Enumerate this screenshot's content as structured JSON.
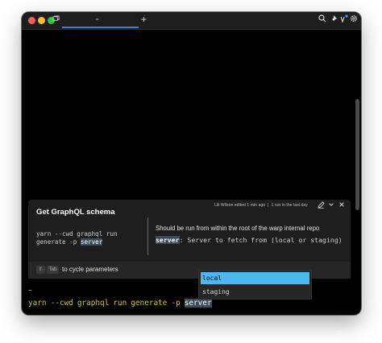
{
  "titlebar": {
    "tab_label": "-",
    "new_tab_label": "+"
  },
  "workflow": {
    "title": "Get GraphQL schema",
    "meta_author": "Lili Wilson edited 1 min ago",
    "meta_separator": "|",
    "meta_runs": "1 run in the last day",
    "command_line1": "yarn --cwd graphql run",
    "command_line2_prefix": "generate -p",
    "command_param": "server",
    "description": "Should be run from within the root of the warp internal repo",
    "param_name": "server",
    "param_description": ": Server to fetch from (local or staging)",
    "hint_key1": "⇧",
    "hint_key2": "Tab",
    "hint_text": "to cycle parameters"
  },
  "terminal": {
    "cwd": "~",
    "tokens": [
      "yarn",
      "--cwd",
      "graphql",
      "run",
      "generate",
      "-p"
    ],
    "param": "server"
  },
  "dropdown": {
    "options": [
      "local",
      "staging"
    ],
    "selected_index": 0
  },
  "colors": {
    "accent": "#3b82d6",
    "selected_option": "#4eb6f0",
    "command_text": "#c9c14a"
  }
}
